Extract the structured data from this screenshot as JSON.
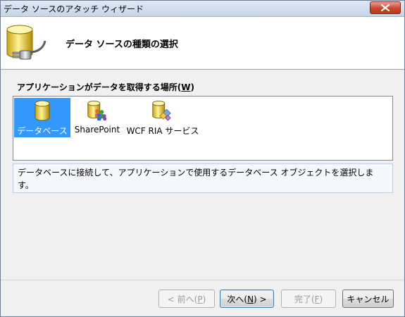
{
  "window": {
    "title": "データ ソースのアタッチ ウィザード"
  },
  "header": {
    "title": "データ ソースの種類の選択"
  },
  "source_list": {
    "label_prefix": "アプリケーションがデータを取得する場所(",
    "label_key": "W",
    "label_suffix": ")",
    "items": [
      {
        "label": "データベース",
        "icon": "database-icon",
        "selected": true
      },
      {
        "label": "SharePoint",
        "icon": "sharepoint-icon",
        "selected": false
      },
      {
        "label": "WCF RIA サービス",
        "icon": "wcf-ria-service-icon",
        "selected": false
      }
    ]
  },
  "description": "データベースに接続して、アプリケーションで使用するデータベース オブジェクトを選択します。",
  "buttons": {
    "back": {
      "prefix": "< 前へ(",
      "key": "P",
      "suffix": ")",
      "enabled": false
    },
    "next": {
      "prefix": "次へ(",
      "key": "N",
      "suffix": ") >",
      "enabled": true
    },
    "finish": {
      "prefix": "完了(",
      "key": "F",
      "suffix": ")",
      "enabled": false
    },
    "cancel": {
      "label": "キャンセル",
      "enabled": true
    }
  },
  "colors": {
    "selection": "#3399ff",
    "close_button": "#c9472c"
  }
}
